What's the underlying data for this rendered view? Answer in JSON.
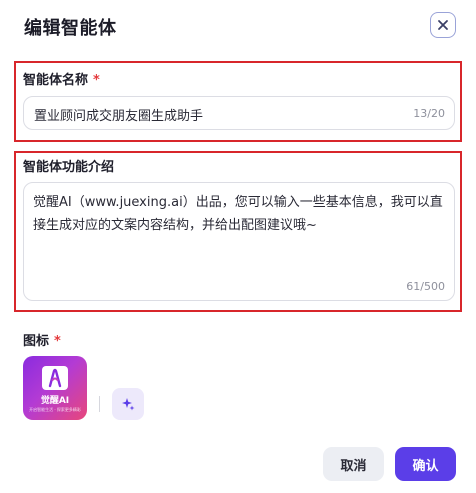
{
  "dialog": {
    "title": "编辑智能体",
    "close_icon": "close-icon"
  },
  "name_field": {
    "label": "智能体名称",
    "required_mark": "*",
    "value": "置业顾问成交朋友圈生成助手",
    "counter": "13/20"
  },
  "description_field": {
    "label": "智能体功能介绍",
    "value": "觉醒AI（www.juexing.ai）出品，您可以输入一些基本信息，我可以直接生成对应的文案内容结构，并给出配图建议哦~",
    "counter": "61/500"
  },
  "icon_field": {
    "label": "图标",
    "required_mark": "*",
    "preview_icon": "app-logo-icon",
    "logo_caption": "觉醒AI",
    "logo_subtext": "开启智能生活 · 探索更多精彩",
    "generate_icon": "sparkle-icon"
  },
  "footer": {
    "cancel_label": "取消",
    "confirm_label": "确认"
  },
  "colors": {
    "accent": "#5b3ee8",
    "highlight_border": "#d8262b",
    "required": "#e4393c"
  }
}
